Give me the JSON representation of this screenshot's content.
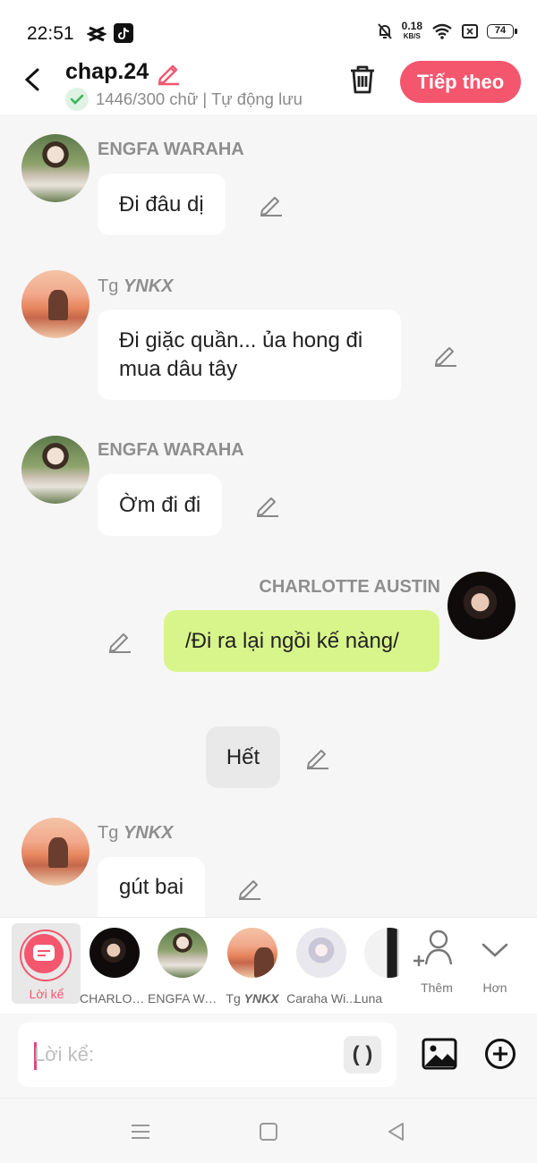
{
  "status_bar": {
    "time": "22:51",
    "speed_value": "0.18",
    "speed_unit": "KB/S",
    "battery": "74"
  },
  "header": {
    "title": "chap.24",
    "meta": "1446/300 chữ | Tự động lưu",
    "next_label": "Tiếp theo"
  },
  "messages": [
    {
      "sender": "ENGFA WARAHA",
      "text": "Đi đâu dị"
    },
    {
      "sender_prefix": "Tg ",
      "sender_name": "YNKX",
      "text": "Đi giặc quần... ủa hong đi mua dâu tây"
    },
    {
      "sender": "ENGFA WARAHA",
      "text": "Ờm đi đi"
    },
    {
      "sender": "CHARLOTTE AUSTIN",
      "text": "/Đi ra lại ngồi kế nàng/"
    },
    {
      "text": "Hết"
    },
    {
      "sender_prefix": "Tg ",
      "sender_name": "YNKX",
      "text": "gút bai"
    }
  ],
  "characters": [
    {
      "label": "Lời kể"
    },
    {
      "label": "CHARLOTTE AUSTIN"
    },
    {
      "label": "ENGFA WARAHA"
    },
    {
      "label_prefix": "Tg ",
      "label_name": "YNKX"
    },
    {
      "label": "Caraha Wi..."
    },
    {
      "label": "Luna"
    }
  ],
  "tools": {
    "add_label": "Thêm",
    "more_label": "Hơn"
  },
  "input": {
    "placeholder": "Lời kể:",
    "paren_label": "( )"
  },
  "colors": {
    "accent": "#f4566e",
    "bubble_self": "#d8f58b",
    "background": "#f6f6f6"
  }
}
